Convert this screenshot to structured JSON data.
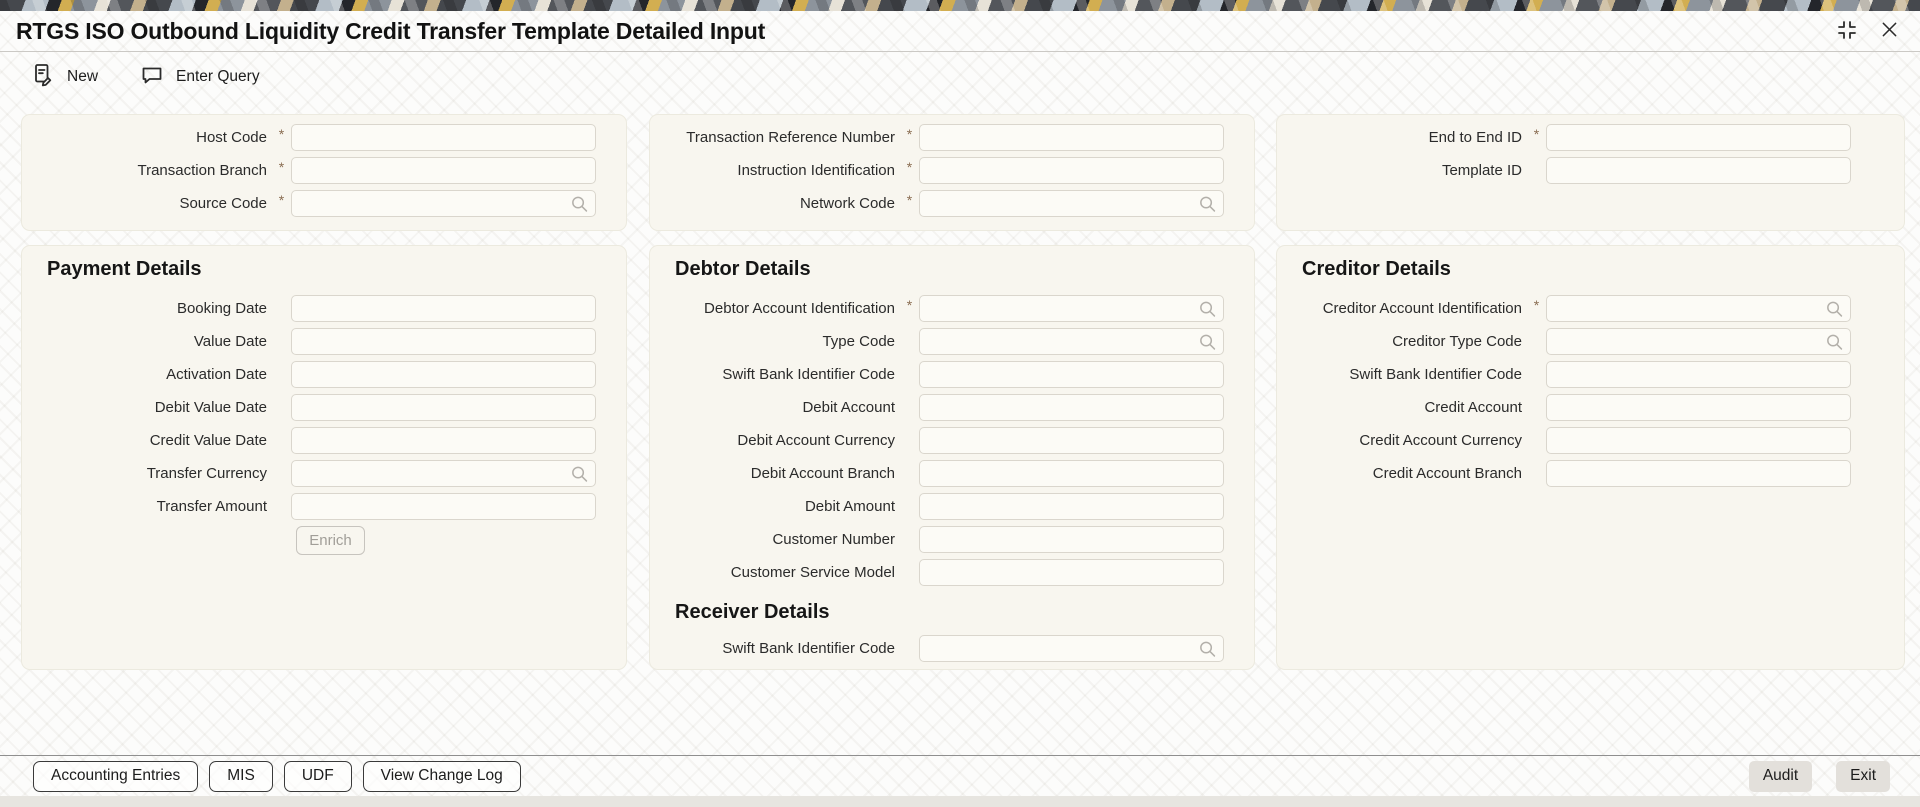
{
  "window": {
    "title": "RTGS ISO Outbound Liquidity Credit Transfer Template Detailed Input"
  },
  "required_marker": "*",
  "toolbar": {
    "new": "New",
    "enter_query": "Enter Query"
  },
  "top_section": {
    "fields": {
      "host_code": {
        "label": "Host Code",
        "required": true
      },
      "transaction_branch": {
        "label": "Transaction Branch",
        "required": true
      },
      "source_code": {
        "label": "Source Code",
        "required": true,
        "lov": true
      },
      "transaction_reference_number": {
        "label": "Transaction Reference Number",
        "required": true
      },
      "instruction_identification": {
        "label": "Instruction Identification",
        "required": true
      },
      "network_code": {
        "label": "Network Code",
        "required": true,
        "lov": true
      },
      "end_to_end_id": {
        "label": "End to End ID",
        "required": true
      },
      "template_id": {
        "label": "Template ID",
        "required": false
      }
    }
  },
  "payment_details": {
    "title": "Payment Details",
    "fields": {
      "booking_date": {
        "label": "Booking Date"
      },
      "value_date": {
        "label": "Value Date"
      },
      "activation_date": {
        "label": "Activation Date"
      },
      "debit_value_date": {
        "label": "Debit Value Date"
      },
      "credit_value_date": {
        "label": "Credit Value Date"
      },
      "transfer_currency": {
        "label": "Transfer Currency",
        "lov": true
      },
      "transfer_amount": {
        "label": "Transfer Amount"
      }
    },
    "enrich_button": "Enrich"
  },
  "debtor_details": {
    "title": "Debtor Details",
    "fields": {
      "debtor_account_identification": {
        "label": "Debtor Account Identification",
        "required": true,
        "lov": true
      },
      "type_code": {
        "label": "Type Code",
        "lov": true
      },
      "swift_bank_identifier_code": {
        "label": "Swift Bank Identifier Code"
      },
      "debit_account": {
        "label": "Debit Account"
      },
      "debit_account_currency": {
        "label": "Debit Account Currency"
      },
      "debit_account_branch": {
        "label": "Debit Account Branch"
      },
      "debit_amount": {
        "label": "Debit Amount"
      },
      "customer_number": {
        "label": "Customer Number"
      },
      "customer_service_model": {
        "label": "Customer Service Model"
      }
    }
  },
  "receiver_details": {
    "title": "Receiver Details",
    "fields": {
      "swift_bank_identifier_code": {
        "label": "Swift Bank Identifier Code",
        "lov": true
      }
    }
  },
  "creditor_details": {
    "title": "Creditor Details",
    "fields": {
      "creditor_account_identification": {
        "label": "Creditor Account Identification",
        "required": true,
        "lov": true
      },
      "creditor_type_code": {
        "label": "Creditor Type Code",
        "lov": true
      },
      "swift_bank_identifier_code": {
        "label": "Swift Bank Identifier Code"
      },
      "credit_account": {
        "label": "Credit Account"
      },
      "credit_account_currency": {
        "label": "Credit Account Currency"
      },
      "credit_account_branch": {
        "label": "Credit Account Branch"
      }
    }
  },
  "footer": {
    "accounting_entries": "Accounting Entries",
    "mis": "MIS",
    "udf": "UDF",
    "view_change_log": "View Change Log",
    "audit": "Audit",
    "exit": "Exit"
  },
  "colors": {
    "accent_required": "#8a6d52",
    "panel_bg": "#f8f6ef",
    "footer_button_bg": "#e3e0db",
    "banner_palette": [
      "#45484d",
      "#b3bdc6",
      "#24262b",
      "#d2ae51",
      "#8d949c",
      "#e7e2d7",
      "#c3b08d"
    ]
  }
}
